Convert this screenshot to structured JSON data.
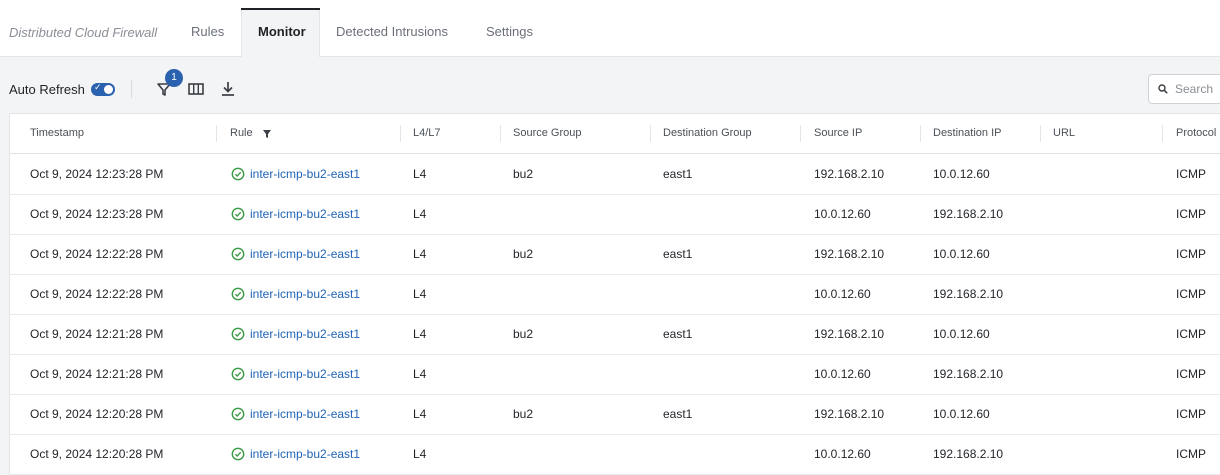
{
  "tabs": {
    "brand": "Distributed Cloud Firewall",
    "items": [
      "Rules",
      "Monitor",
      "Detected Intrusions",
      "Settings"
    ],
    "active": "Monitor"
  },
  "toolbar": {
    "auto_refresh_label": "Auto Refresh",
    "auto_refresh_on": true,
    "filter_count": "1",
    "search_placeholder": "Search",
    "icons": [
      "filter-icon",
      "columns-icon",
      "download-icon",
      "search-icon"
    ]
  },
  "colors": {
    "accent": "#2b62b0",
    "link": "#1f63b5",
    "success": "#3c9a44"
  },
  "table": {
    "columns": [
      "Timestamp",
      "Rule",
      "L4/L7",
      "Source Group",
      "Destination Group",
      "Source IP",
      "Destination IP",
      "URL",
      "Protocol"
    ],
    "rows": [
      {
        "timestamp": "Oct 9, 2024 12:23:28 PM",
        "rule": "inter-icmp-bu2-east1",
        "layer": "L4",
        "source_group": "bu2",
        "dest_group": "east1",
        "source_ip": "192.168.2.10",
        "dest_ip": "10.0.12.60",
        "url": "",
        "protocol": "ICMP"
      },
      {
        "timestamp": "Oct 9, 2024 12:23:28 PM",
        "rule": "inter-icmp-bu2-east1",
        "layer": "L4",
        "source_group": "",
        "dest_group": "",
        "source_ip": "10.0.12.60",
        "dest_ip": "192.168.2.10",
        "url": "",
        "protocol": "ICMP"
      },
      {
        "timestamp": "Oct 9, 2024 12:22:28 PM",
        "rule": "inter-icmp-bu2-east1",
        "layer": "L4",
        "source_group": "bu2",
        "dest_group": "east1",
        "source_ip": "192.168.2.10",
        "dest_ip": "10.0.12.60",
        "url": "",
        "protocol": "ICMP"
      },
      {
        "timestamp": "Oct 9, 2024 12:22:28 PM",
        "rule": "inter-icmp-bu2-east1",
        "layer": "L4",
        "source_group": "",
        "dest_group": "",
        "source_ip": "10.0.12.60",
        "dest_ip": "192.168.2.10",
        "url": "",
        "protocol": "ICMP"
      },
      {
        "timestamp": "Oct 9, 2024 12:21:28 PM",
        "rule": "inter-icmp-bu2-east1",
        "layer": "L4",
        "source_group": "bu2",
        "dest_group": "east1",
        "source_ip": "192.168.2.10",
        "dest_ip": "10.0.12.60",
        "url": "",
        "protocol": "ICMP"
      },
      {
        "timestamp": "Oct 9, 2024 12:21:28 PM",
        "rule": "inter-icmp-bu2-east1",
        "layer": "L4",
        "source_group": "",
        "dest_group": "",
        "source_ip": "10.0.12.60",
        "dest_ip": "192.168.2.10",
        "url": "",
        "protocol": "ICMP"
      },
      {
        "timestamp": "Oct 9, 2024 12:20:28 PM",
        "rule": "inter-icmp-bu2-east1",
        "layer": "L4",
        "source_group": "bu2",
        "dest_group": "east1",
        "source_ip": "192.168.2.10",
        "dest_ip": "10.0.12.60",
        "url": "",
        "protocol": "ICMP"
      },
      {
        "timestamp": "Oct 9, 2024 12:20:28 PM",
        "rule": "inter-icmp-bu2-east1",
        "layer": "L4",
        "source_group": "",
        "dest_group": "",
        "source_ip": "10.0.12.60",
        "dest_ip": "192.168.2.10",
        "url": "",
        "protocol": "ICMP"
      }
    ]
  }
}
